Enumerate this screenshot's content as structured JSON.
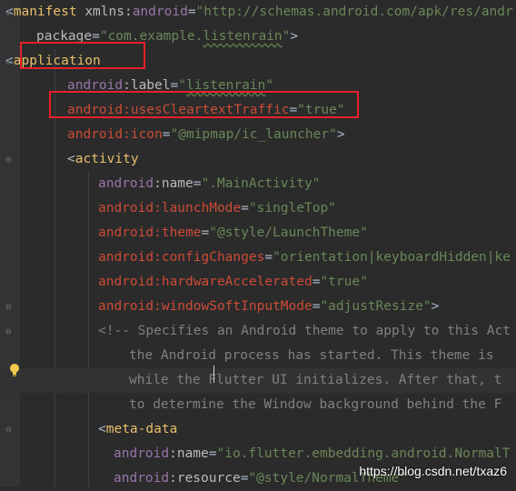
{
  "editor": {
    "lines": [
      {
        "id": "l1",
        "indent": 0,
        "parts": [
          [
            "punct",
            "<"
          ],
          [
            "tag",
            "manifest "
          ],
          [
            "attr",
            "xmlns:"
          ],
          [
            "ns",
            "android"
          ],
          [
            "punct",
            "="
          ],
          [
            "str",
            "\"http://schemas.android.com/apk/res/andr"
          ]
        ]
      },
      {
        "id": "l2",
        "indent": 1,
        "parts": [
          [
            "attr",
            "package"
          ],
          [
            "punct",
            "="
          ],
          [
            "str",
            "\"com.example."
          ],
          [
            "str-ul",
            "listenrain"
          ],
          [
            "str",
            "\""
          ],
          [
            "punct",
            ">"
          ]
        ]
      },
      {
        "id": "l3",
        "indent": 0,
        "parts": [
          [
            "punct",
            "<"
          ],
          [
            "tag",
            "application"
          ]
        ]
      },
      {
        "id": "l4",
        "indent": 2,
        "parts": [
          [
            "ns",
            "android"
          ],
          [
            "attr",
            ":label"
          ],
          [
            "punct",
            "="
          ],
          [
            "str",
            "\""
          ],
          [
            "str-ul",
            "listenrain"
          ],
          [
            "str",
            "\""
          ]
        ]
      },
      {
        "id": "l5",
        "indent": 2,
        "parts": [
          [
            "red-nsattr",
            "android:usesCleartextTraffic"
          ],
          [
            "punct",
            "="
          ],
          [
            "str",
            "\"true\""
          ]
        ]
      },
      {
        "id": "l6",
        "indent": 2,
        "parts": [
          [
            "red-nsattr",
            "android:icon"
          ],
          [
            "punct",
            "="
          ],
          [
            "str",
            "\"@mipmap/ic_launcher\""
          ],
          [
            "punct",
            ">"
          ]
        ]
      },
      {
        "id": "l7",
        "indent": 2,
        "parts": [
          [
            "punct",
            "<"
          ],
          [
            "tag",
            "activity"
          ]
        ]
      },
      {
        "id": "l8",
        "indent": 3,
        "parts": [
          [
            "ns",
            "android"
          ],
          [
            "attr",
            ":name"
          ],
          [
            "punct",
            "="
          ],
          [
            "str",
            "\".MainActivity\""
          ]
        ]
      },
      {
        "id": "l9",
        "indent": 3,
        "parts": [
          [
            "red-nsattr",
            "android:launchMode"
          ],
          [
            "punct",
            "="
          ],
          [
            "str",
            "\"singleTop\""
          ]
        ]
      },
      {
        "id": "l10",
        "indent": 3,
        "parts": [
          [
            "red-nsattr",
            "android:theme"
          ],
          [
            "punct",
            "="
          ],
          [
            "str",
            "\"@style/LaunchTheme\""
          ]
        ]
      },
      {
        "id": "l11",
        "indent": 3,
        "parts": [
          [
            "red-nsattr",
            "android:configChanges"
          ],
          [
            "punct",
            "="
          ],
          [
            "str",
            "\"orientation|keyboardHidden|ke"
          ]
        ]
      },
      {
        "id": "l12",
        "indent": 3,
        "parts": [
          [
            "red-nsattr",
            "android:hardwareAccelerated"
          ],
          [
            "punct",
            "="
          ],
          [
            "str",
            "\"true\""
          ]
        ]
      },
      {
        "id": "l13",
        "indent": 3,
        "parts": [
          [
            "red-nsattr",
            "android:windowSoftInputMode"
          ],
          [
            "punct",
            "="
          ],
          [
            "str",
            "\"adjustResize\""
          ],
          [
            "punct",
            ">"
          ]
        ]
      },
      {
        "id": "l14",
        "indent": 3,
        "parts": [
          [
            "cmt",
            "<!-- Specifies an Android theme to apply to this Act"
          ]
        ]
      },
      {
        "id": "l15",
        "indent": 4,
        "parts": [
          [
            "cmt",
            "the Android process has started. This theme is"
          ]
        ]
      },
      {
        "id": "l16",
        "indent": 4,
        "parts": [
          [
            "cmt",
            "while the Flutter UI initializes. After that, t"
          ]
        ]
      },
      {
        "id": "l17",
        "indent": 4,
        "parts": [
          [
            "cmt",
            "to determine the Window background behind the F"
          ]
        ]
      },
      {
        "id": "l18",
        "indent": 3,
        "parts": [
          [
            "punct",
            "<"
          ],
          [
            "tag",
            "meta-data"
          ]
        ]
      },
      {
        "id": "l19",
        "indent": 3.5,
        "parts": [
          [
            "ns",
            "android"
          ],
          [
            "attr",
            ":name"
          ],
          [
            "punct",
            "="
          ],
          [
            "str",
            "\"io.flutter.embedding.android.NormalT"
          ]
        ]
      },
      {
        "id": "l20",
        "indent": 3.5,
        "parts": [
          [
            "ns",
            "android"
          ],
          [
            "attr",
            ":resource"
          ],
          [
            "punct",
            "="
          ],
          [
            "str",
            "\"@style/NormalTheme\""
          ]
        ]
      }
    ]
  },
  "colors": {
    "background": "#2b2b2b",
    "highlight_box": "#e8202a",
    "tag": "#e8bf6a",
    "string": "#6a8759",
    "namespace": "#9876aa",
    "comment": "#808080"
  },
  "watermark": "https://blog.csdn.net/txaz6"
}
